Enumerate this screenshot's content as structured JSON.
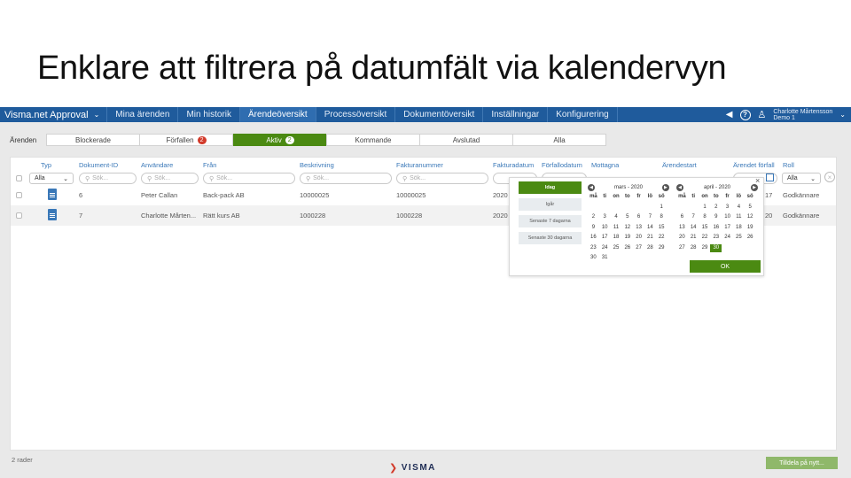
{
  "slide": {
    "title": "Enklare att filtrera på datumfält via kalendervyn"
  },
  "topbar": {
    "app_name": "Visma.net Approval",
    "nav": [
      "Mina ärenden",
      "Min historik",
      "Ärendeöversikt",
      "Processöversikt",
      "Dokumentöversikt",
      "Inställningar",
      "Konfigurering"
    ],
    "active_nav": "Ärendeöversikt",
    "user_name": "Charlotte Mårtensson",
    "user_company": "Demo 1",
    "help": "?"
  },
  "tabs": {
    "label": "Ärenden",
    "items": [
      {
        "label": "Blockerade",
        "badge": ""
      },
      {
        "label": "Förfallen",
        "badge": "2"
      },
      {
        "label": "Aktiv",
        "badge": "2"
      },
      {
        "label": "Kommande",
        "badge": ""
      },
      {
        "label": "Avslutad",
        "badge": ""
      },
      {
        "label": "Alla",
        "badge": ""
      }
    ]
  },
  "table": {
    "headers": {
      "typ": "Typ",
      "dokument_id": "Dokument-ID",
      "anvandare": "Användare",
      "fran": "Från",
      "beskrivning": "Beskrivning",
      "fakturanummer": "Fakturanummer",
      "fakturadatum": "Fakturadatum",
      "forfallodatum": "Förfallodatum",
      "mottagna": "Mottagna",
      "arendestart": "Ärendestart",
      "arendet_forfall": "Ärendet förfall",
      "roll": "Roll"
    },
    "filters": {
      "search_placeholder": "Sök...",
      "typ_select": "Alla",
      "roll_select": "Alla",
      "clear": "×"
    },
    "rows": [
      {
        "dokument_id": "6",
        "anvandare": "Peter Callan",
        "fran": "Back-pack AB",
        "beskrivning": "10000025",
        "fakturanummer": "10000025",
        "fakturadatum": "2020",
        "arendet_forfall": "17",
        "roll": "Godkännare"
      },
      {
        "dokument_id": "7",
        "anvandare": "Charlotte Mårten...",
        "fran": "Rätt kurs AB",
        "beskrivning": "1000228",
        "fakturanummer": "1000228",
        "fakturadatum": "2020",
        "arendet_forfall": "20",
        "roll": "Godkännare"
      }
    ]
  },
  "datepicker": {
    "quick": [
      "Idag",
      "Igår",
      "Senaste 7 dagarna",
      "Senaste 30 dagarna"
    ],
    "active_quick": "Idag",
    "weekdays": [
      "må",
      "ti",
      "on",
      "to",
      "fr",
      "lö",
      "sö"
    ],
    "month1": {
      "title": "mars - 2020",
      "days": [
        "",
        "",
        "",
        "",
        "",
        "",
        "1",
        "2",
        "3",
        "4",
        "5",
        "6",
        "7",
        "8",
        "9",
        "10",
        "11",
        "12",
        "13",
        "14",
        "15",
        "16",
        "17",
        "18",
        "19",
        "20",
        "21",
        "22",
        "23",
        "24",
        "25",
        "26",
        "27",
        "28",
        "29",
        "30",
        "31"
      ]
    },
    "month2": {
      "title": "april - 2020",
      "days": [
        "",
        "",
        "1",
        "2",
        "3",
        "4",
        "5",
        "6",
        "7",
        "8",
        "9",
        "10",
        "11",
        "12",
        "13",
        "14",
        "15",
        "16",
        "17",
        "18",
        "19",
        "20",
        "21",
        "22",
        "23",
        "24",
        "25",
        "26",
        "27",
        "28",
        "29",
        "30"
      ],
      "selected": "30"
    },
    "ok": "OK",
    "close": "×"
  },
  "footer": {
    "row_count": "2 rader",
    "logo": "VISMA",
    "assign_button": "Tilldela på nytt..."
  },
  "colors": {
    "nav_blue": "#1f5b9c",
    "accent_green": "#4b8a12",
    "badge_red": "#d23a2a",
    "link_blue": "#3a78b8"
  }
}
